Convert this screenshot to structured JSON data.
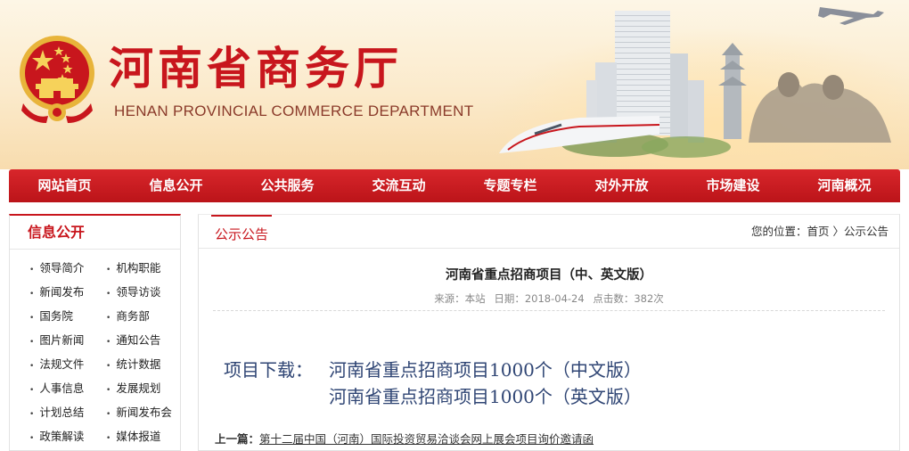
{
  "header": {
    "title": "河南省商务厅",
    "subtitle": "HENAN PROVINCIAL COMMERCE DEPARTMENT"
  },
  "nav": {
    "items": [
      {
        "label": "网站首页"
      },
      {
        "label": "信息公开"
      },
      {
        "label": "公共服务"
      },
      {
        "label": "交流互动"
      },
      {
        "label": "专题专栏"
      },
      {
        "label": "对外开放"
      },
      {
        "label": "市场建设"
      },
      {
        "label": "河南概况"
      }
    ]
  },
  "sidebar": {
    "heading": "信息公开",
    "bullet": "•",
    "items": [
      {
        "label": "领导简介"
      },
      {
        "label": "机构职能"
      },
      {
        "label": "新闻发布"
      },
      {
        "label": "领导访谈"
      },
      {
        "label": "国务院"
      },
      {
        "label": "商务部"
      },
      {
        "label": "图片新闻"
      },
      {
        "label": "通知公告"
      },
      {
        "label": "法规文件"
      },
      {
        "label": "统计数据"
      },
      {
        "label": "人事信息"
      },
      {
        "label": "发展规划"
      },
      {
        "label": "计划总结"
      },
      {
        "label": "新闻发布会"
      },
      {
        "label": "政策解读"
      },
      {
        "label": "媒体报道"
      }
    ]
  },
  "main": {
    "tab": "公示公告",
    "breadcrumb": {
      "prefix": "您的位置：",
      "home": "首页",
      "separator": " 〉",
      "current": "公示公告"
    },
    "article": {
      "title": "河南省重点招商项目（中、英文版）",
      "source_label": "来源：本站",
      "date_label": "日期：2018-04-24",
      "clicks_label": "点击数：382次",
      "download_label": "项目下载：",
      "downloads": [
        {
          "label": "河南省重点招商项目1000个（中文版）"
        },
        {
          "label": "河南省重点招商项目1000个（英文版）"
        }
      ]
    },
    "prev": {
      "label": "上一篇：",
      "link": "第十二届中国（河南）国际投资贸易洽谈会网上展会项目询价邀请函"
    }
  },
  "colors": {
    "brand_red": "#c8161d",
    "nav_red": "#d8262b",
    "link_blue": "#2f4574"
  }
}
